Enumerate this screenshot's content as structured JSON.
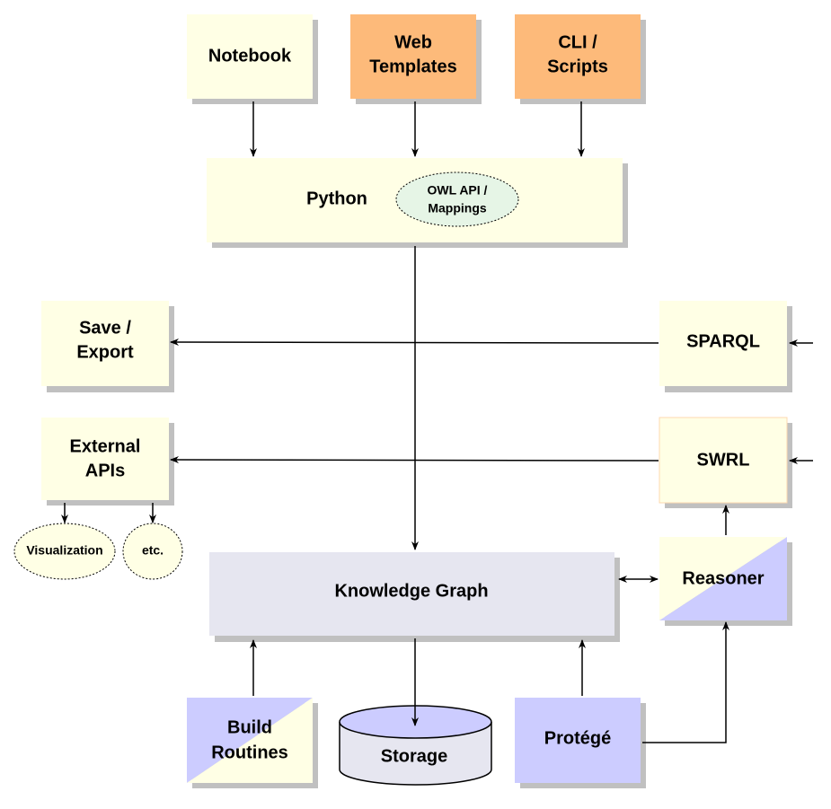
{
  "colors": {
    "yellow": "#FFFFE5",
    "orange": "#FDBA7A",
    "purple": "#CCCCFF",
    "graph": "#E6E6F0",
    "owl_ellipse": "#E6F5E6",
    "shadow": "#C0C0C0"
  },
  "nodes": {
    "notebook": [
      "Notebook"
    ],
    "web_templates": [
      "Web",
      "Templates"
    ],
    "cli_scripts": [
      "CLI /",
      "Scripts"
    ],
    "python": [
      "Python"
    ],
    "owl_api": [
      "OWL API /",
      "Mappings"
    ],
    "save_export": [
      "Save /",
      "Export"
    ],
    "external_apis": [
      "External",
      "APIs"
    ],
    "visualization": [
      "Visualization"
    ],
    "etc": [
      "etc."
    ],
    "sparql": [
      "SPARQL"
    ],
    "swrl": [
      "SWRL"
    ],
    "reasoner": [
      "Reasoner"
    ],
    "knowledge_graph": [
      "Knowledge Graph"
    ],
    "build_routines": [
      "Build",
      "Routines"
    ],
    "storage": [
      "Storage"
    ],
    "protege": [
      "Protégé"
    ]
  }
}
